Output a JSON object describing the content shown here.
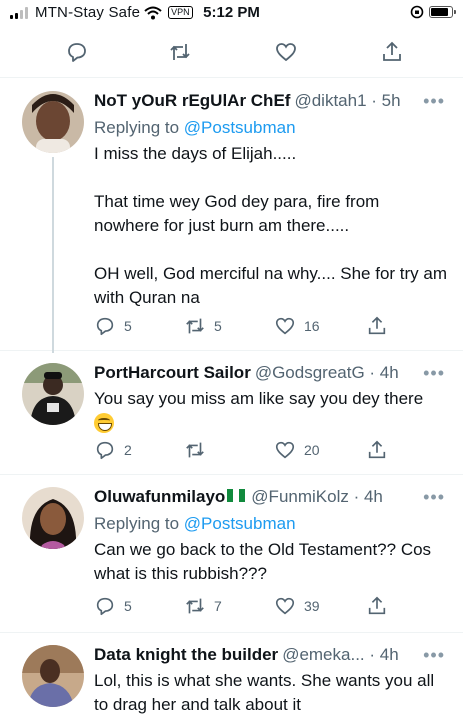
{
  "status_bar": {
    "carrier": "MTN-Stay Safe",
    "vpn": "VPN",
    "time": "5:12 PM",
    "signal_bars_active": 2,
    "signal_bars_total": 4,
    "battery_level": 0.85
  },
  "top_actions": [
    "reply-icon",
    "retweet-icon",
    "like-icon",
    "share-icon"
  ],
  "tweets": [
    {
      "name": "NoT yOuR rEgUlAr ChEf",
      "handle": "@diktah1 · 5h",
      "replying_prefix": "Replying to ",
      "replying_to": "@Postsubman",
      "body": [
        "I miss the days of Elijah.....",
        "That time wey God dey para, fire from nowhere for just burn am there.....",
        "OH well, God merciful na why.... She for try am with Quran na"
      ],
      "replies": "5",
      "retweets": "5",
      "likes": "16"
    },
    {
      "name": "PortHarcourt Sailor",
      "handle": "@GodsgreatG · 4h",
      "body_line": "You say you miss am like say you dey there",
      "emoji": "grinning-face-emoji",
      "replies": "2",
      "retweets": "",
      "likes": "20"
    },
    {
      "name": "Oluwafunmilayo",
      "flag": "nigeria-flag",
      "handle": "@FunmiKolz · 4h",
      "replying_prefix": "Replying to ",
      "replying_to": "@Postsubman",
      "body": [
        "Can we go back to the Old Testament?? Cos what is this rubbish???"
      ],
      "replies": "5",
      "retweets": "7",
      "likes": "39"
    },
    {
      "name": "Data knight the builder",
      "handle": "@emeka... · 4h",
      "body": [
        "Lol, this is what she wants. She wants you all to drag her and talk about it"
      ]
    }
  ],
  "colors": {
    "accent": "#1d9bf0",
    "muted": "#536471",
    "text": "#0f1419",
    "divider": "#eff3f4",
    "thread_line": "#cfd9de"
  }
}
